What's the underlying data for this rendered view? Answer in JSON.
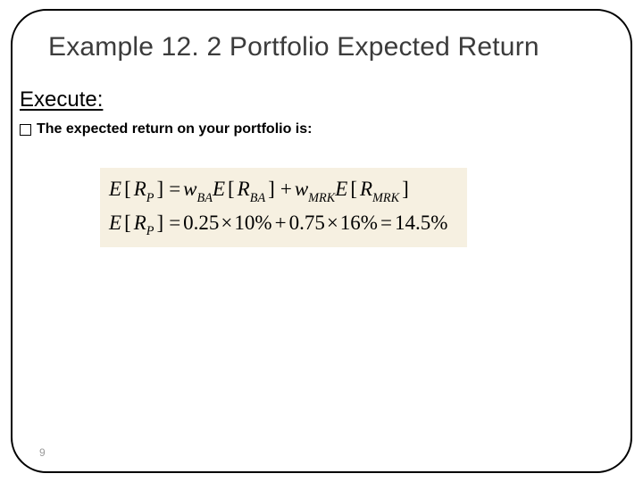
{
  "title": "Example 12. 2 Portfolio Expected Return",
  "section_heading": "Execute:",
  "bullet_text": "The expected return on your portfolio is:",
  "formula": {
    "line1": {
      "lhs_var": "E",
      "lhs_inner_var": "R",
      "lhs_inner_sub": "P",
      "t1_w_var": "w",
      "t1_w_sub": "BA",
      "t1_e_var": "E",
      "t1_r_var": "R",
      "t1_r_sub": "BA",
      "t2_w_var": "w",
      "t2_w_sub": "MRK",
      "t2_e_var": "E",
      "t2_r_var": "R",
      "t2_r_sub": "MRK"
    },
    "line2": {
      "lhs_var": "E",
      "lhs_inner_var": "R",
      "lhs_inner_sub": "P",
      "w1": "0.25",
      "r1": "10%",
      "w2": "0.75",
      "r2": "16%",
      "result": "14.5%"
    }
  },
  "page_number": "9"
}
